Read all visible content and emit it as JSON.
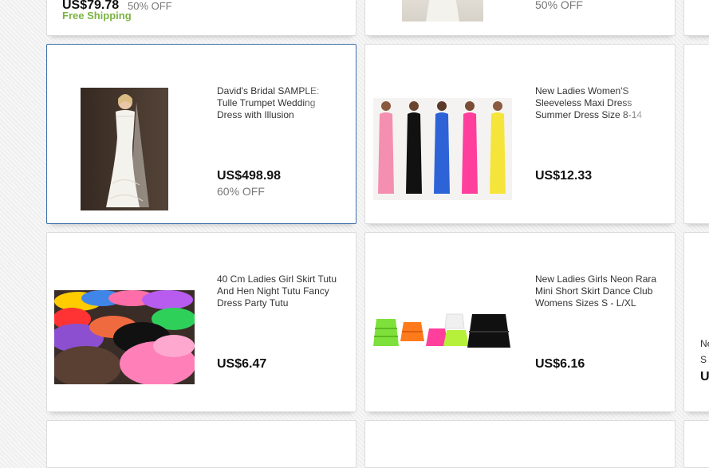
{
  "cards": [
    {
      "price": "US$79.78",
      "discount": "50% OFF",
      "shipping": "Free Shipping"
    },
    {
      "discount": "50% OFF"
    },
    {
      "title": "David's Bridal SAMPLE: Tulle Trumpet Wedding Dress with Illusion Neckline",
      "price": "US$498.98",
      "discount": "60% OFF",
      "selected": true
    },
    {
      "title": "New Ladies Women'S Sleeveless Maxi Dress Summer Dress Size 8-14",
      "price": "US$12.33"
    },
    {
      "title": "40 Cm Ladies Girl Skirt Tutu And Hen Night Tutu Fancy Dress Party Tutu",
      "price": "US$6.47"
    },
    {
      "title": "New Ladies Girls Neon Rara Mini Short Skirt Dance Club Womens Sizes S - L/XL",
      "price": "US$6.16"
    },
    {
      "title_fragment_1": "Ne",
      "title_fragment_2": "S",
      "price_fragment": "U"
    }
  ],
  "colors": {
    "accent_free_shipping": "#7cb342",
    "selected_border": "#3d6fa8",
    "pink": "#f48fb1",
    "hot_pink": "#ff3f9b",
    "neon_green": "#7ee03a",
    "neon_orange": "#ff7a1a",
    "blue": "#2e63d8",
    "yellow": "#f5e53a"
  }
}
